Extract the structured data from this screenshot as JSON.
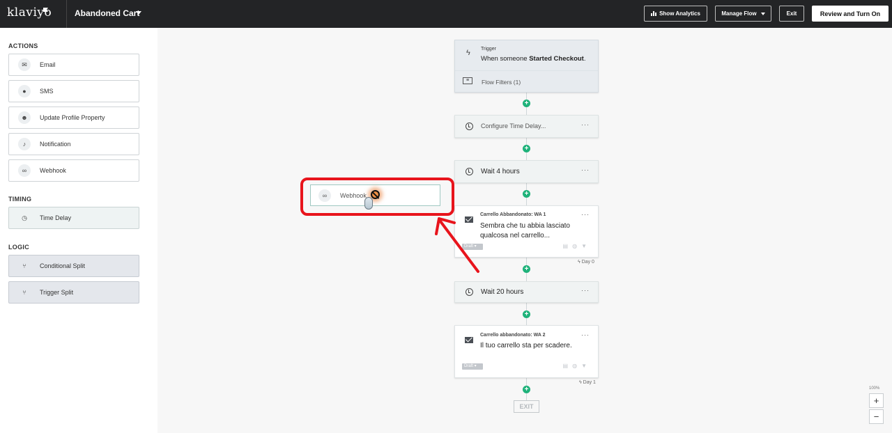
{
  "topbar": {
    "logo": "klaviyo",
    "flow_name": "Abandoned Cart",
    "show_analytics": "Show Analytics",
    "manage_flow": "Manage Flow",
    "exit": "Exit",
    "review": "Review and Turn On"
  },
  "sidebar": {
    "actions_title": "ACTIONS",
    "actions": [
      {
        "label": "Email",
        "icon": "envelope-icon"
      },
      {
        "label": "SMS",
        "icon": "chat-icon"
      },
      {
        "label": "Update Profile Property",
        "icon": "person-icon"
      },
      {
        "label": "Notification",
        "icon": "bell-icon"
      },
      {
        "label": "Webhook",
        "icon": "webhook-icon"
      }
    ],
    "timing_title": "TIMING",
    "timing": [
      {
        "label": "Time Delay",
        "icon": "clock-icon"
      }
    ],
    "logic_title": "LOGIC",
    "logic": [
      {
        "label": "Conditional Split",
        "icon": "split-icon"
      },
      {
        "label": "Trigger Split",
        "icon": "trigger-split-icon"
      }
    ]
  },
  "flow": {
    "trigger": {
      "kicker": "Trigger",
      "text_prefix": "When someone ",
      "text_bold": "Started Checkout",
      "text_suffix": ".",
      "filters": "Flow Filters (1)"
    },
    "config_delay": "Configure Time Delay...",
    "wait1": "Wait 4 hours",
    "email1": {
      "name": "Carrello Abbandonato: WA 1",
      "body": "Sembra che tu abbia lasciato qualcosa nel carrello...",
      "status": "Draft",
      "day": "Day 0"
    },
    "wait2": "Wait 20 hours",
    "email2": {
      "name": "Carrello abbandonato: WA 2",
      "body": "Il tuo carrello sta per scadere.",
      "status": "Draft",
      "day": "Day 1"
    },
    "exit": "EXIT"
  },
  "drag": {
    "label": "Webhook"
  },
  "zoom": {
    "level": "100%",
    "plus": "+",
    "minus": "−"
  },
  "colors": {
    "topbar": "#232426",
    "accent_green": "#1fb27a",
    "annotation_red": "#e8141c"
  }
}
